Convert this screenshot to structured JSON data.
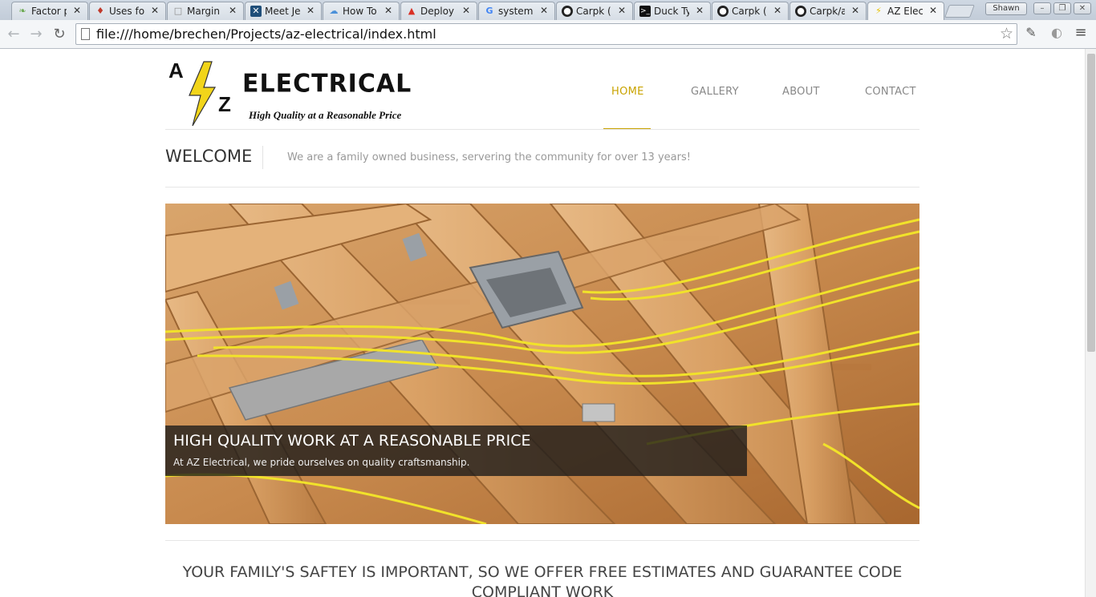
{
  "browser": {
    "tabs": [
      {
        "title": "Factor p",
        "icon": "leaf-icon",
        "color": "#6aa84f"
      },
      {
        "title": "Uses fo",
        "icon": "ruby-icon",
        "color": "#c0392b"
      },
      {
        "title": "Margin",
        "icon": "document-icon",
        "color": "#888888"
      },
      {
        "title": "Meet Je",
        "icon": "jenkins-icon",
        "color": "#1f4e79"
      },
      {
        "title": "How To",
        "icon": "cloud-icon",
        "color": "#4a90d9"
      },
      {
        "title": "Deploy",
        "icon": "triangle-icon",
        "color": "#d93025"
      },
      {
        "title": "system",
        "icon": "google-icon",
        "color": "#4285f4"
      },
      {
        "title": "Carpk (",
        "icon": "github-icon",
        "color": "#222222"
      },
      {
        "title": "Duck Ty",
        "icon": "terminal-icon",
        "color": "#111111"
      },
      {
        "title": "Carpk (",
        "icon": "github-icon",
        "color": "#222222"
      },
      {
        "title": "Carpk/a",
        "icon": "github-icon",
        "color": "#222222"
      },
      {
        "title": "AZ Elec",
        "icon": "bolt-icon",
        "color": "#e6c200"
      }
    ],
    "active_tab": 11,
    "profile_name": "Shawn",
    "url": "file:///home/brechen/Projects/az-electrical/index.html"
  },
  "site": {
    "logo": {
      "letter_a": "A",
      "letter_z": "Z",
      "brand": "ELECTRICAL",
      "tagline": "High Quality at a Reasonable Price"
    },
    "nav": [
      {
        "label": "HOME",
        "active": true
      },
      {
        "label": "GALLERY",
        "active": false
      },
      {
        "label": "ABOUT",
        "active": false
      },
      {
        "label": "CONTACT",
        "active": false
      }
    ],
    "accent_color": "#c9a300",
    "welcome": {
      "title": "WELCOME",
      "subtitle": "We are a family owned business, servering the community for over 13 years!"
    },
    "hero": {
      "caption_title": "HIGH QUALITY WORK AT A REASONABLE PRICE",
      "caption_text": "At AZ Electrical, we pride ourselves on quality craftsmanship."
    },
    "headline": "YOUR FAMILY'S SAFTEY IS IMPORTANT, SO WE OFFER FREE ESTIMATES AND GUARANTEE CODE COMPLIANT WORK"
  }
}
